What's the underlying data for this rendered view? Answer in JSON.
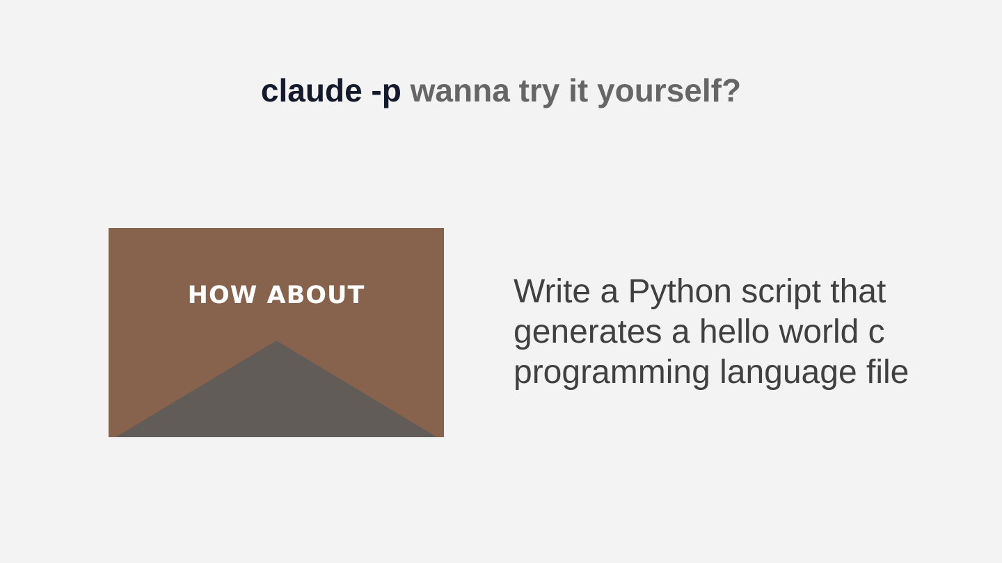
{
  "slide": {
    "title_command": "claude -p",
    "title_rest": "wanna try it yourself?",
    "illustration": {
      "label": "HOW ABOUT",
      "background_color": "#87624c",
      "shape_color": "#625c58",
      "shape": "triangle"
    },
    "prompt_lines": [
      "Write a Python script that",
      "generates a hello world c",
      "programming language file"
    ]
  }
}
